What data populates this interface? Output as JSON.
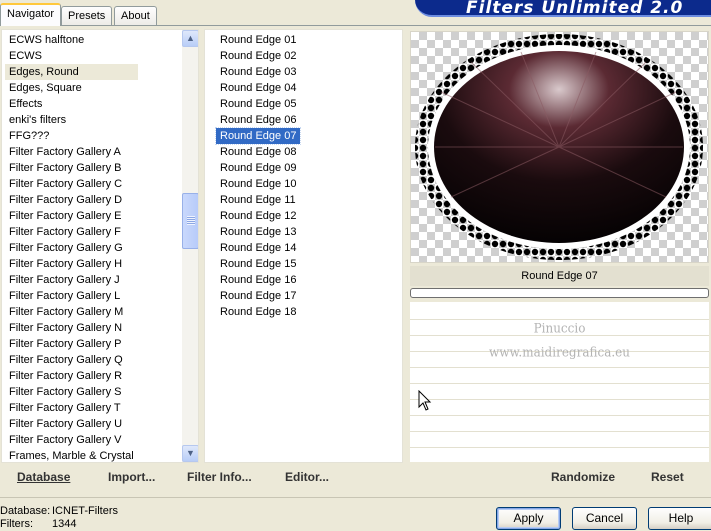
{
  "banner": {
    "title": "Filters Unlimited 2.0"
  },
  "tabs": [
    {
      "label": "Navigator",
      "active": true
    },
    {
      "label": "Presets",
      "active": false
    },
    {
      "label": "About",
      "active": false
    }
  ],
  "categories": {
    "selected": "Edges, Round",
    "items": [
      "ECWS halftone",
      "ECWS",
      "Edges, Round",
      "Edges, Square",
      "Effects",
      "enki's filters",
      "FFG???",
      "Filter Factory Gallery A",
      "Filter Factory Gallery B",
      "Filter Factory Gallery C",
      "Filter Factory Gallery D",
      "Filter Factory Gallery E",
      "Filter Factory Gallery F",
      "Filter Factory Gallery G",
      "Filter Factory Gallery H",
      "Filter Factory Gallery J",
      "Filter Factory Gallery L",
      "Filter Factory Gallery M",
      "Filter Factory Gallery N",
      "Filter Factory Gallery P",
      "Filter Factory Gallery Q",
      "Filter Factory Gallery R",
      "Filter Factory Gallery S",
      "Filter Factory Gallery T",
      "Filter Factory Gallery U",
      "Filter Factory Gallery V",
      "Frames, Marble & Crystal"
    ]
  },
  "filters": {
    "selected": "Round Edge 07",
    "items": [
      "Round Edge 01",
      "Round Edge 02",
      "Round Edge 03",
      "Round Edge 04",
      "Round Edge 05",
      "Round Edge 06",
      "Round Edge 07",
      "Round Edge 08",
      "Round Edge 09",
      "Round Edge 10",
      "Round Edge 11",
      "Round Edge 12",
      "Round Edge 13",
      "Round Edge 14",
      "Round Edge 15",
      "Round Edge 16",
      "Round Edge 17",
      "Round Edge 18"
    ]
  },
  "preview": {
    "caption": "Round Edge 07",
    "watermark_line1": "Pinuccio",
    "watermark_line2": "www.maidiregrafica.eu"
  },
  "toolbar": {
    "database": "Database",
    "import": "Import...",
    "filter_info": "Filter Info...",
    "editor": "Editor...",
    "randomize": "Randomize",
    "reset": "Reset"
  },
  "status": {
    "database_label": "Database:",
    "database_value": "ICNET-Filters",
    "filters_label": "Filters:",
    "filters_value": "1344"
  },
  "dialog_buttons": {
    "apply": "Apply",
    "cancel": "Cancel",
    "help": "Help"
  },
  "colors": {
    "selection": "#316ac5",
    "banner": "#0c2a8c",
    "face": "#ece9d8"
  },
  "icons": {
    "scroll_up": "up-arrow-icon",
    "scroll_down": "down-arrow-icon",
    "cursor": "mouse-pointer-icon"
  }
}
